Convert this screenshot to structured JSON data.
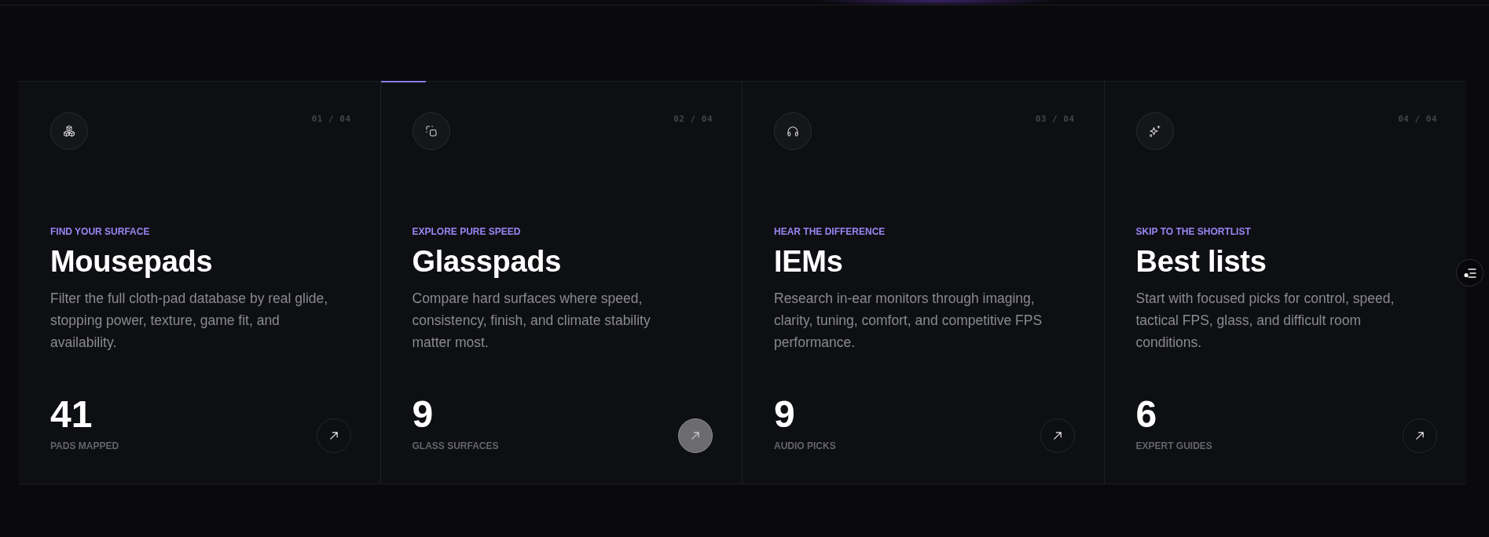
{
  "cards": [
    {
      "counter": "01 / 04",
      "eyebrow": "FIND YOUR SURFACE",
      "title": "Mousepads",
      "description": "Filter the full cloth-pad database by real glide, stopping power, texture, game fit, and availability.",
      "count": "41",
      "count_label": "PADS MAPPED",
      "selected": false
    },
    {
      "counter": "02 / 04",
      "eyebrow": "EXPLORE PURE SPEED",
      "title": "Glasspads",
      "description": "Compare hard surfaces where speed, consistency, finish, and climate stability matter most.",
      "count": "9",
      "count_label": "GLASS SURFACES",
      "selected": true
    },
    {
      "counter": "03 / 04",
      "eyebrow": "HEAR THE DIFFERENCE",
      "title": "IEMs",
      "description": "Research in-ear monitors through imaging, clarity, tuning, comfort, and competitive FPS performance.",
      "count": "9",
      "count_label": "AUDIO PICKS",
      "selected": false
    },
    {
      "counter": "04 / 04",
      "eyebrow": "SKIP TO THE SHORTLIST",
      "title": "Best lists",
      "description": "Start with focused picks for control, speed, tactical FPS, glass, and difficult room conditions.",
      "count": "6",
      "count_label": "EXPERT GUIDES",
      "selected": false
    }
  ]
}
